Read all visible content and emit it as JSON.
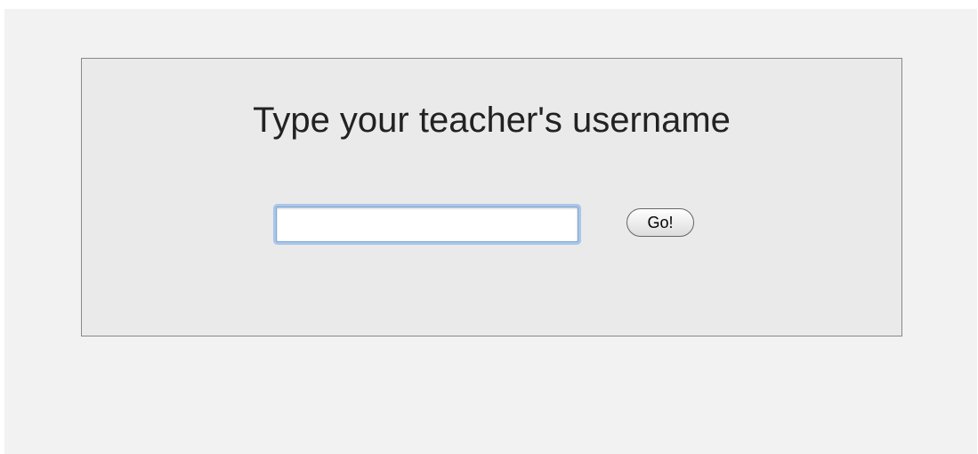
{
  "form": {
    "title": "Type your teacher's username",
    "username_value": "",
    "go_label": "Go!"
  },
  "colors": {
    "page_background": "#f2f2f2",
    "panel_background": "#eaeaea",
    "panel_border": "#888888",
    "focus_ring": "#a9c6ea"
  }
}
